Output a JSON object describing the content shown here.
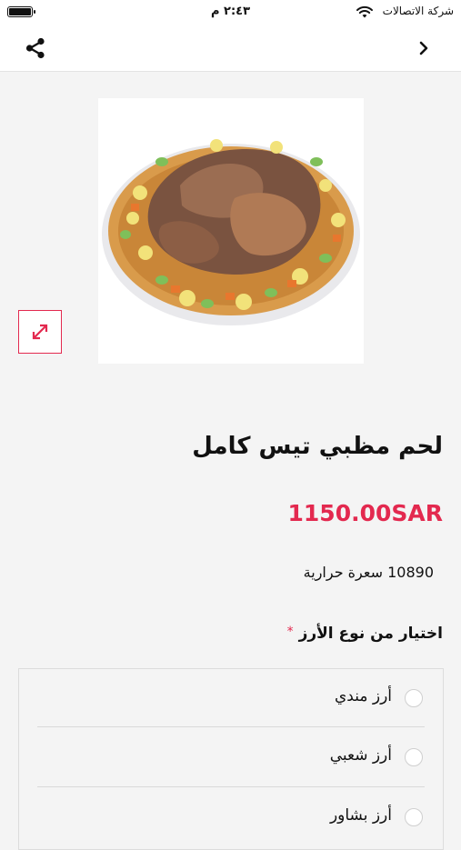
{
  "status_bar": {
    "carrier": "شركة الاتصالات",
    "time": "٢:٤٣ م"
  },
  "nav": {
    "share_icon": "share-icon",
    "back_icon": "chevron-right-icon"
  },
  "product": {
    "image_alt": "لحم مظبي تيس كامل",
    "expand_icon": "expand-icon",
    "title": "لحم مظبي تيس كامل",
    "price": "1150.00SAR",
    "calories": "10890 سعرة حرارية"
  },
  "rice_options": {
    "title": "اختيار من نوع الأرز",
    "required_mark": "*",
    "items": [
      {
        "label": "أرز مندي",
        "selected": false
      },
      {
        "label": "أرز شعبي",
        "selected": false
      },
      {
        "label": "أرز بشاور",
        "selected": false
      }
    ]
  },
  "colors": {
    "accent": "#e3294f",
    "background": "#f4f4f4"
  }
}
